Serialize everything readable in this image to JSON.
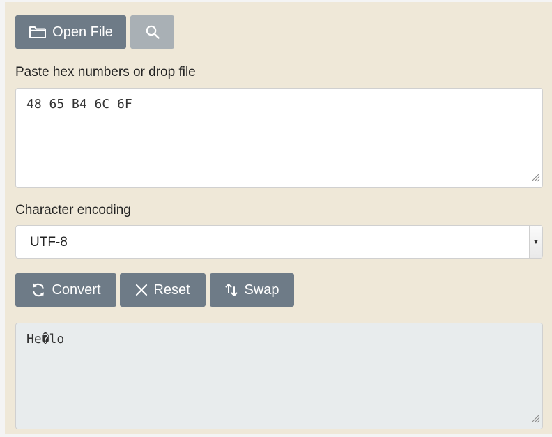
{
  "toolbar": {
    "open_file_label": "Open File"
  },
  "input": {
    "label": "Paste hex numbers or drop file",
    "value": "48 65 B4 6C 6F"
  },
  "encoding": {
    "label": "Character encoding",
    "selected": "UTF-8"
  },
  "actions": {
    "convert_label": "Convert",
    "reset_label": "Reset",
    "swap_label": "Swap"
  },
  "output": {
    "value": "He�lo"
  },
  "colors": {
    "button": "#6e7b87",
    "button_muted": "#a9b0b5",
    "panel": "#efe8d8",
    "output_bg": "#e8eced"
  }
}
